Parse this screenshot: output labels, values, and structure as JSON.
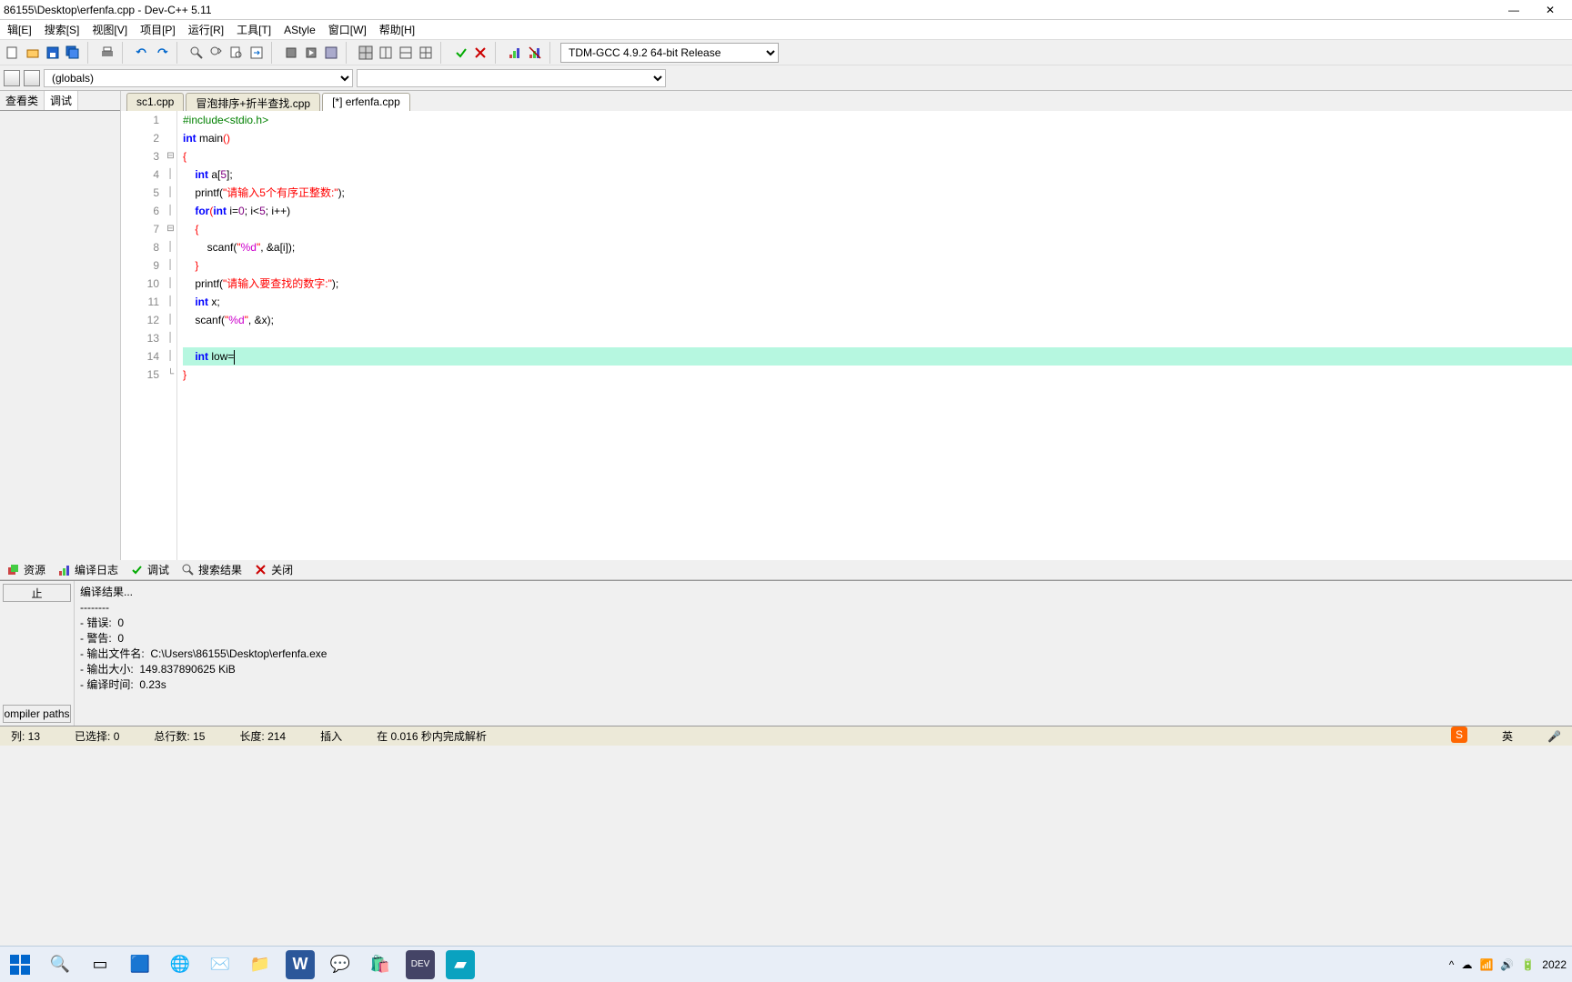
{
  "window": {
    "title": "86155\\Desktop\\erfenfa.cpp - Dev-C++ 5.11"
  },
  "menu": {
    "edit": "辑[E]",
    "search": "搜索[S]",
    "view": "视图[V]",
    "project": "项目[P]",
    "run": "运行[R]",
    "tools": "工具[T]",
    "astyle": "AStyle",
    "window": "窗口[W]",
    "help": "帮助[H]"
  },
  "toolbar": {
    "compiler_selected": "TDM-GCC 4.9.2 64-bit Release"
  },
  "selector": {
    "globals": "(globals)"
  },
  "sidebar": {
    "tab_classes": "查看类",
    "tab_debug": "调试"
  },
  "tabs": {
    "t1": "sc1.cpp",
    "t2": "冒泡排序+折半查找.cpp",
    "t3": "[*] erfenfa.cpp"
  },
  "code": {
    "l1_pp": "#include<stdio.h>",
    "l2_kw1": "int",
    "l2_id": " main",
    "l2_pr": "()",
    "l3": "{",
    "l4_kw": "int",
    "l4_rest": " a[",
    "l4_num": "5",
    "l4_end": "];",
    "l5_fn": "printf(",
    "l5_str": "\"请输入5个有序正整数:\"",
    "l5_end": ");",
    "l6_for": "for",
    "l6_op": "(",
    "l6_int": "int",
    "l6_mid": " i=",
    "l6_n0": "0",
    "l6_s1": "; i<",
    "l6_n5": "5",
    "l6_s2": "; i++)",
    "l7": "{",
    "l8_fn": "scanf(",
    "l8_str": "\"",
    "l8_spec": "%d",
    "l8_str2": "\"",
    "l8_mid": ", &a[i]);",
    "l9": "}",
    "l10_fn": "printf(",
    "l10_str": "\"请输入要查找的数字:\"",
    "l10_end": ");",
    "l11_kw": "int",
    "l11_rest": " x;",
    "l12_fn": "scanf(",
    "l12_str": "\"",
    "l12_spec": "%d",
    "l12_str2": "\"",
    "l12_mid": ", &x);",
    "l14_kw": "int",
    "l14_rest": " low=",
    "l15": "}"
  },
  "bottom_tabs": {
    "resources": "资源",
    "compilelog": "编译日志",
    "debug": "调试",
    "searchres": "搜索结果",
    "close": "关闭"
  },
  "compile": {
    "header": "编译结果...",
    "sep": "--------",
    "err": "- 错误:  0",
    "warn": "- 警告:  0",
    "outname": "- 输出文件名:  C:\\Users\\86155\\Desktop\\erfenfa.exe",
    "outsize": "- 输出大小:  149.837890625 KiB",
    "time": "- 编译时间:  0.23s"
  },
  "btn": {
    "stop": "止",
    "paths": "ompiler paths"
  },
  "status": {
    "col": "列:   13",
    "sel": "已选择:   0",
    "total": "总行数:   15",
    "len": "长度:   214",
    "ins": "插入",
    "parse": "在 0.016 秒内完成解析"
  },
  "tray": {
    "ime1": "英",
    "year": "2022"
  }
}
